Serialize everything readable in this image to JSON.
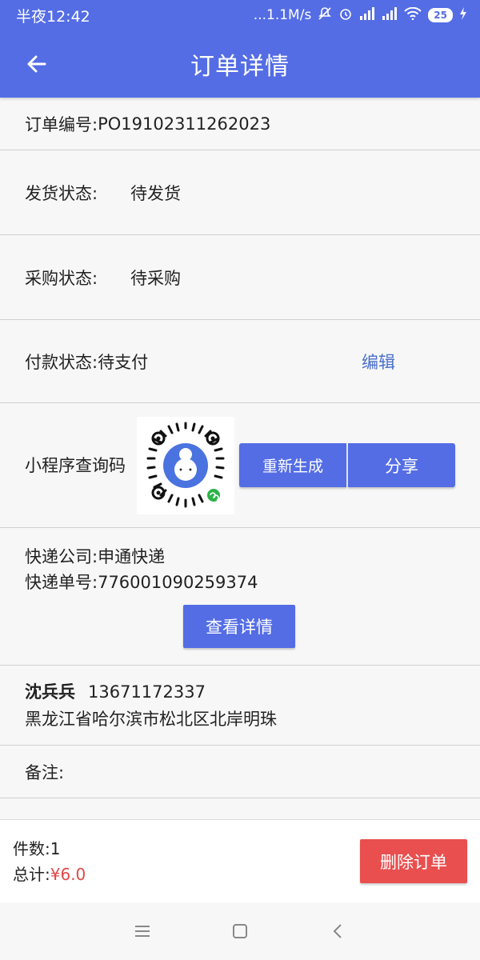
{
  "status_bar": {
    "time": "半夜12:42",
    "network": "...1.1M/s",
    "battery": "25"
  },
  "app_bar": {
    "title": "订单详情",
    "back_icon": "arrow-left-icon"
  },
  "order": {
    "number_label": "订单编号:",
    "number": "PO19102311262023"
  },
  "shipping": {
    "label": "发货状态:",
    "value": "待发货"
  },
  "purchase": {
    "label": "采购状态:",
    "value": "待采购"
  },
  "payment": {
    "label": "付款状态:",
    "value": "待支付",
    "edit_label": "编辑"
  },
  "mini_program": {
    "label": "小程序查询码",
    "regenerate_label": "重新生成",
    "share_label": "分享"
  },
  "express": {
    "company_label": "快递公司:",
    "company": "申通快递",
    "tracking_label": "快递单号:",
    "tracking": "776001090259374",
    "view_label": "查看详情"
  },
  "recipient": {
    "name": "沈兵兵",
    "phone": "13671172337",
    "address": "黑龙江省哈尔滨市松北区北岸明珠"
  },
  "note": {
    "label": "备注:"
  },
  "summary": {
    "count_label": "件数:",
    "count": "1",
    "total_label": "总计:",
    "total": "¥6.0",
    "delete_label": "删除订单"
  },
  "colors": {
    "primary": "#546de5",
    "danger": "#e94f4f",
    "link": "#4a6fc9"
  }
}
